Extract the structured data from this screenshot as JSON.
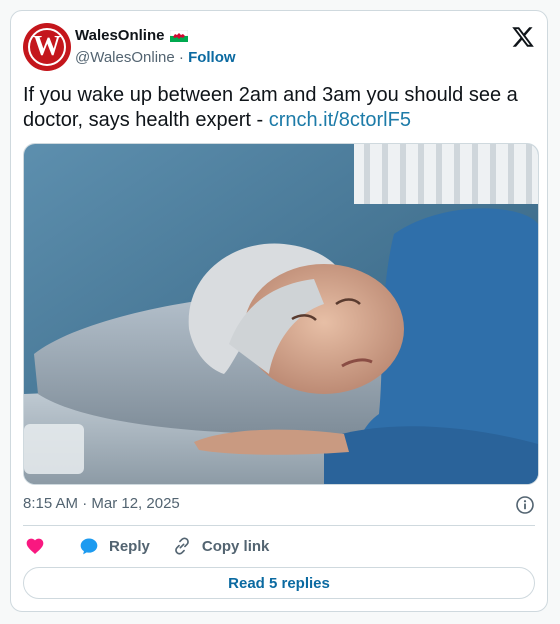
{
  "tweet": {
    "author": {
      "display_name": "WalesOnline",
      "handle": "@WalesOnline",
      "avatar_letter": "W",
      "flag_icon": "welsh-flag-icon",
      "avatar_color": "#c4161c"
    },
    "separator": "·",
    "follow_label": "Follow",
    "text": "If you wake up between 2am and 3am you should see a doctor, says health expert - ",
    "link": "crnch.it/8ctorlF5",
    "media": {
      "icon": "photo-woman-lying-awake-in-bed"
    },
    "timestamp": "8:15 AM · Mar 12, 2025",
    "actions": {
      "like_icon": "heart-icon",
      "reply_label": "Reply",
      "copy_link_label": "Copy link"
    },
    "read_replies_label": "Read 5 replies",
    "colors": {
      "link": "#1d7ba8",
      "follow": "#0b6aa1",
      "heart": "#f91880",
      "reply_icon": "#1d9bf0",
      "muted_text": "#536471",
      "border": "#cfd9de"
    }
  }
}
